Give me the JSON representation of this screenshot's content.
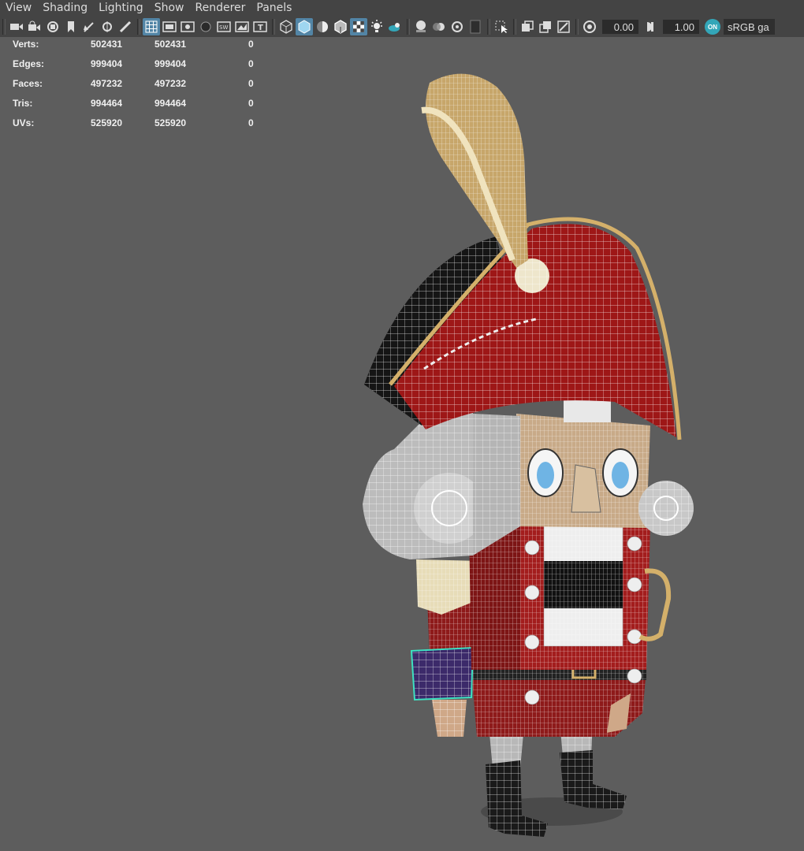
{
  "menu": [
    "View",
    "Shading",
    "Lighting",
    "Show",
    "Renderer",
    "Panels"
  ],
  "toolbar": {
    "exposure_value": "0.00",
    "gamma_value": "1.00",
    "color_mgmt_badge": "ON",
    "color_space": "sRGB ga"
  },
  "hud": {
    "rows": [
      {
        "label": "Verts:",
        "a": "502431",
        "b": "502431",
        "c": "0"
      },
      {
        "label": "Edges:",
        "a": "999404",
        "b": "999404",
        "c": "0"
      },
      {
        "label": "Faces:",
        "a": "497232",
        "b": "497232",
        "c": "0"
      },
      {
        "label": "Tris:",
        "a": "994464",
        "b": "994464",
        "c": "0"
      },
      {
        "label": "UVs:",
        "a": "525920",
        "b": "525920",
        "c": "0"
      }
    ]
  },
  "colors": {
    "viewport_bg": "#5d5d5d",
    "toolbar_bg": "#444444",
    "selected_tool": "#5285a6",
    "badge": "#33a6b8"
  },
  "icons": [
    "camera-icon",
    "grid-icon",
    "wireframe-icon",
    "smooth-shade-icon",
    "textured-icon",
    "light-icon",
    "shadow-icon",
    "isolate-icon",
    "exposure-icon",
    "gamma-icon"
  ]
}
